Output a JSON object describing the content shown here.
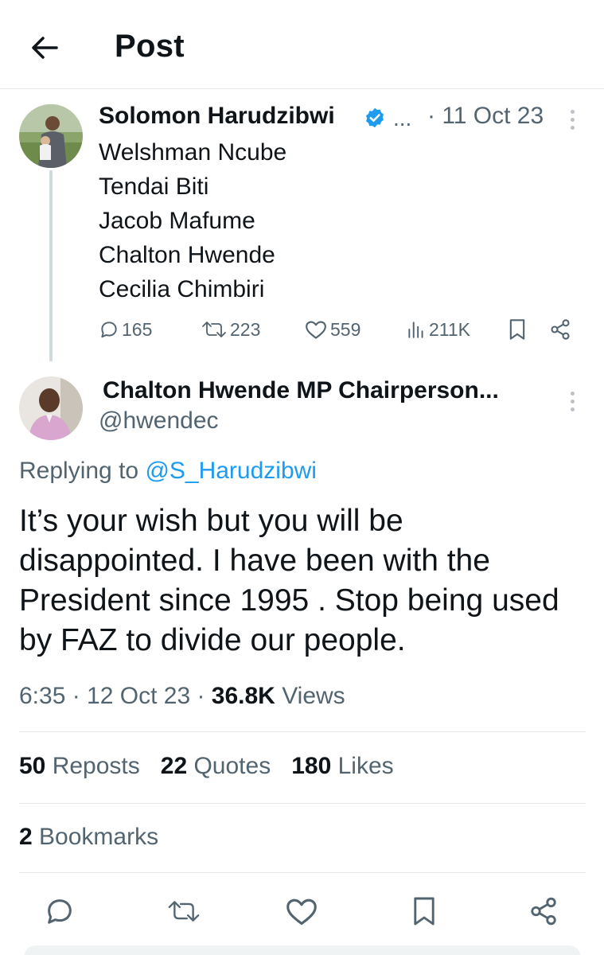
{
  "header": {
    "title": "Post"
  },
  "parent": {
    "author": "Solomon Harudzibwi",
    "ellipsis": "...",
    "time": "· 11 Oct 23",
    "lines": [
      "Welshman Ncube",
      "Tendai Biti",
      "Jacob Mafume",
      "Chalton Hwende",
      "Cecilia Chimbiri"
    ],
    "replies": "165",
    "reposts": "223",
    "likes": "559",
    "views": "211K"
  },
  "post": {
    "author": "Chalton Hwende MP Chairperson...",
    "handle": "@hwendec",
    "replying_prefix": "Replying to ",
    "replying_to": "@S_Harudzibwi",
    "text": "It’s your wish but you will be disappointed. I have been with the President since 1995 . Stop being used by FAZ to divide our people.",
    "time": "6:35 · 12 Oct 23 · ",
    "views_count": "36.8K",
    "views_label": " Views",
    "reposts_count": "50",
    "reposts_label": " Reposts",
    "quotes_count": "22",
    "quotes_label": " Quotes",
    "likes_count": "180",
    "likes_label": " Likes",
    "bookmarks_count": "2",
    "bookmarks_label": " Bookmarks"
  },
  "colors": {
    "text": "#0f1419",
    "muted": "#536471",
    "accent": "#1d9bf0",
    "divider": "#e6e9ec"
  },
  "icons": [
    "back-arrow-icon",
    "verified-badge-icon",
    "more-icon",
    "reply-icon",
    "repost-icon",
    "like-icon",
    "views-icon",
    "bookmark-icon",
    "share-icon"
  ]
}
